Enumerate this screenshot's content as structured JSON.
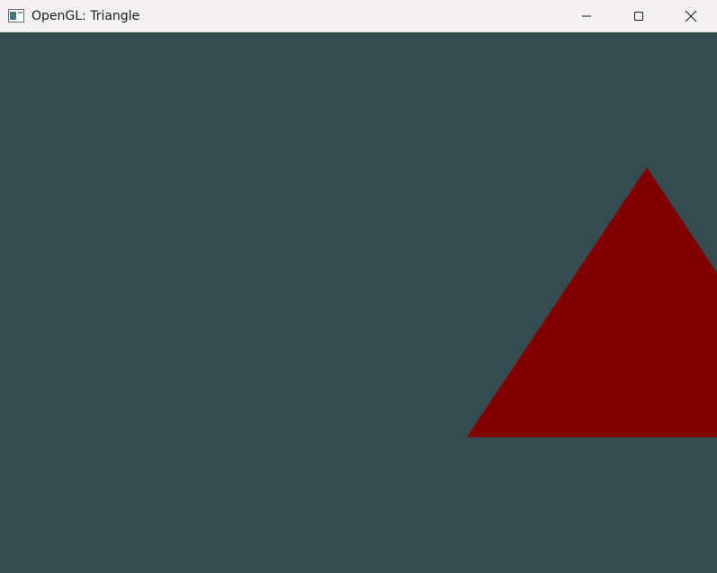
{
  "window": {
    "title": "OpenGL: Triangle"
  },
  "icons": {
    "app": "opengl-app-icon",
    "minimize": "minimize-icon",
    "maximize": "maximize-icon",
    "close": "close-icon"
  },
  "colors": {
    "clear_color": "#344c4d",
    "triangle_fill": "#800000",
    "titlebar": "#f3f1f2"
  }
}
